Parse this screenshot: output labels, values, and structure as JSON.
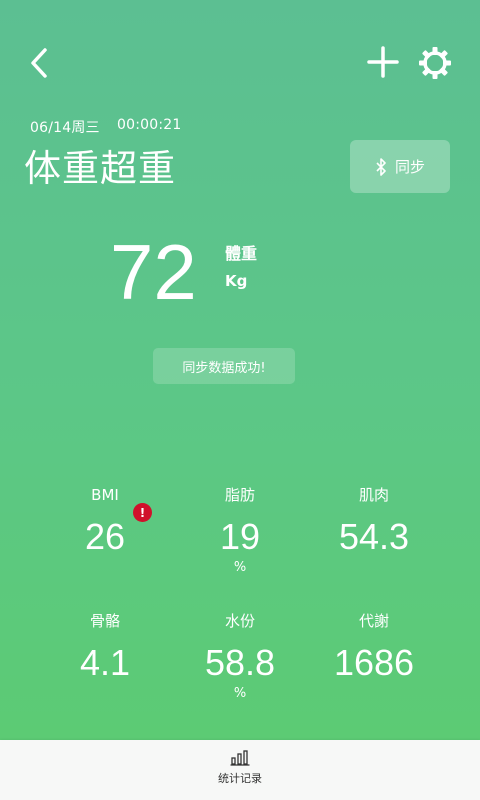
{
  "header": {
    "date": "06/14周三",
    "time": "00:00:21",
    "status": "体重超重",
    "sync_label": "同步"
  },
  "weight": {
    "value": "72",
    "label": "體重",
    "unit": "Kg"
  },
  "toast": "同步数据成功!",
  "metrics": [
    {
      "label": "BMI",
      "value": "26",
      "unit": ""
    },
    {
      "label": "脂肪",
      "value": "19",
      "unit": "%"
    },
    {
      "label": "肌肉",
      "value": "54.3",
      "unit": ""
    },
    {
      "label": "骨骼",
      "value": "4.1",
      "unit": ""
    },
    {
      "label": "水份",
      "value": "58.8",
      "unit": "%"
    },
    {
      "label": "代謝",
      "value": "1686",
      "unit": ""
    }
  ],
  "bmi_alert": "!",
  "bottom_tab": {
    "label": "统计记录",
    "icon": "bar-chart-icon"
  },
  "colors": {
    "bg_top": "#5cbf92",
    "bg_bottom": "#5ccb74",
    "alert": "#d0112b"
  }
}
